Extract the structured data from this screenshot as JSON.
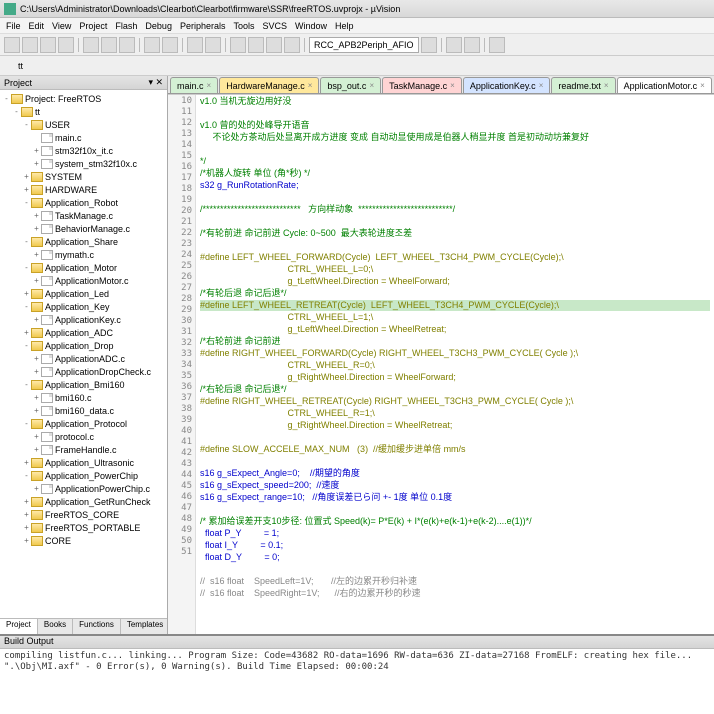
{
  "title": "C:\\Users\\Administrator\\Downloads\\Clearbot\\Clearbot\\firmware\\SSR\\freeRTOS.uvprojx - µVision",
  "menu": [
    "File",
    "Edit",
    "View",
    "Project",
    "Flash",
    "Debug",
    "Peripherals",
    "Tools",
    "SVCS",
    "Window",
    "Help"
  ],
  "toolbar": {
    "target": "tt",
    "device": "RCC_APB2Periph_AFIO"
  },
  "sidebar": {
    "title": "Project",
    "tabs": [
      "Project",
      "Books",
      "Functions",
      "Templates"
    ],
    "root": "Project: FreeRTOS",
    "nodes": [
      {
        "l": "tt",
        "t": "folder",
        "d": 1,
        "e": "-"
      },
      {
        "l": "USER",
        "t": "folder",
        "d": 2,
        "e": "-"
      },
      {
        "l": "main.c",
        "t": "file",
        "d": 3,
        "e": ""
      },
      {
        "l": "stm32f10x_it.c",
        "t": "file",
        "d": 3,
        "e": "+"
      },
      {
        "l": "system_stm32f10x.c",
        "t": "file",
        "d": 3,
        "e": "+"
      },
      {
        "l": "SYSTEM",
        "t": "folder",
        "d": 2,
        "e": "+"
      },
      {
        "l": "HARDWARE",
        "t": "folder",
        "d": 2,
        "e": "+"
      },
      {
        "l": "Application_Robot",
        "t": "folder",
        "d": 2,
        "e": "-"
      },
      {
        "l": "TaskManage.c",
        "t": "file",
        "d": 3,
        "e": "+"
      },
      {
        "l": "BehaviorManage.c",
        "t": "file",
        "d": 3,
        "e": "+"
      },
      {
        "l": "Application_Share",
        "t": "folder",
        "d": 2,
        "e": "-"
      },
      {
        "l": "mymath.c",
        "t": "file",
        "d": 3,
        "e": "+"
      },
      {
        "l": "Application_Motor",
        "t": "folder",
        "d": 2,
        "e": "-"
      },
      {
        "l": "ApplicationMotor.c",
        "t": "file",
        "d": 3,
        "e": "+"
      },
      {
        "l": "Application_Led",
        "t": "folder",
        "d": 2,
        "e": "+"
      },
      {
        "l": "Application_Key",
        "t": "folder",
        "d": 2,
        "e": "-"
      },
      {
        "l": "ApplicationKey.c",
        "t": "file",
        "d": 3,
        "e": "+"
      },
      {
        "l": "Application_ADC",
        "t": "folder",
        "d": 2,
        "e": "+"
      },
      {
        "l": "Application_Drop",
        "t": "folder",
        "d": 2,
        "e": "-"
      },
      {
        "l": "ApplicationADC.c",
        "t": "file",
        "d": 3,
        "e": "+"
      },
      {
        "l": "ApplicationDropCheck.c",
        "t": "file",
        "d": 3,
        "e": "+"
      },
      {
        "l": "Application_Bmi160",
        "t": "folder",
        "d": 2,
        "e": "-"
      },
      {
        "l": "bmi160.c",
        "t": "file",
        "d": 3,
        "e": "+"
      },
      {
        "l": "bmi160_data.c",
        "t": "file",
        "d": 3,
        "e": "+"
      },
      {
        "l": "Application_Protocol",
        "t": "folder",
        "d": 2,
        "e": "-"
      },
      {
        "l": "protocol.c",
        "t": "file",
        "d": 3,
        "e": "+"
      },
      {
        "l": "FrameHandle.c",
        "t": "file",
        "d": 3,
        "e": "+"
      },
      {
        "l": "Application_Ultrasonic",
        "t": "folder",
        "d": 2,
        "e": "+"
      },
      {
        "l": "Application_PowerChip",
        "t": "folder",
        "d": 2,
        "e": "-"
      },
      {
        "l": "ApplicationPowerChip.c",
        "t": "file",
        "d": 3,
        "e": "+"
      },
      {
        "l": "Application_GetRunCheck",
        "t": "folder",
        "d": 2,
        "e": "+"
      },
      {
        "l": "FreeRTOS_CORE",
        "t": "folder",
        "d": 2,
        "e": "+"
      },
      {
        "l": "FreeRTOS_PORTABLE",
        "t": "folder",
        "d": 2,
        "e": "+"
      },
      {
        "l": "CORE",
        "t": "folder",
        "d": 2,
        "e": "+"
      }
    ]
  },
  "editor": {
    "tabs": [
      "main.c",
      "HardwareManage.c",
      "bsp_out.c",
      "TaskManage.c",
      "ApplicationKey.c",
      "readme.txt",
      "ApplicationMotor.c"
    ],
    "active": 6,
    "startLine": 10,
    "lines": [
      {
        "c": "comment",
        "t": "v1.0 当机无旋边用好没"
      },
      {
        "c": "",
        "t": ""
      },
      {
        "c": "comment",
        "t": "v1.0 曾的处的处峰导开语音"
      },
      {
        "c": "comment",
        "t": "     不论处方茶动后处显离开成方进度 变成 自动动显使用成是伯器人稍显并度 首是初动动坊兼复好"
      },
      {
        "c": "",
        "t": ""
      },
      {
        "c": "comment",
        "t": "*/"
      },
      {
        "c": "comment",
        "t": "/*机器人旋转 单位 (角*秒) */"
      },
      {
        "c": "keyword",
        "t": "s32 g_RunRotationRate;"
      },
      {
        "c": "",
        "t": ""
      },
      {
        "c": "comment",
        "t": "/****************************   方向样动象  ***************************/"
      },
      {
        "c": "",
        "t": ""
      },
      {
        "c": "comment",
        "t": "/*有轮前进 命记前进 Cycle: 0~500  最大表轮进度조差"
      },
      {
        "c": "",
        "t": ""
      },
      {
        "c": "macro",
        "t": "#define LEFT_WHEEL_FORWARD(Cycle)  LEFT_WHEEL_T3CH4_PWM_CYCLE(Cycle);\\"
      },
      {
        "c": "macro",
        "t": "                                   CTRL_WHEEL_L=0;\\"
      },
      {
        "c": "macro",
        "t": "                                   g_tLeftWheel.Direction = WheelForward;"
      },
      {
        "c": "comment",
        "t": "/*有轮后退 命记后退*/"
      },
      {
        "c": "macro",
        "t": "#define LEFT_WHEEL_RETREAT(Cycle)  LEFT_WHEEL_T3CH4_PWM_CYCLE(Cycle);\\",
        "hl": true
      },
      {
        "c": "macro",
        "t": "                                   CTRL_WHEEL_L=1;\\"
      },
      {
        "c": "macro",
        "t": "                                   g_tLeftWheel.Direction = WheelRetreat;"
      },
      {
        "c": "comment",
        "t": "/*右轮前进 命记前进"
      },
      {
        "c": "macro",
        "t": "#define RIGHT_WHEEL_FORWARD(Cycle) RIGHT_WHEEL_T3CH3_PWM_CYCLE( Cycle );\\"
      },
      {
        "c": "macro",
        "t": "                                   CTRL_WHEEL_R=0;\\"
      },
      {
        "c": "macro",
        "t": "                                   g_tRightWheel.Direction = WheelForward;"
      },
      {
        "c": "comment",
        "t": "/*右轮后退 命记后退*/"
      },
      {
        "c": "macro",
        "t": "#define RIGHT_WHEEL_RETREAT(Cycle) RIGHT_WHEEL_T3CH3_PWM_CYCLE( Cycle );\\"
      },
      {
        "c": "macro",
        "t": "                                   CTRL_WHEEL_R=1;\\"
      },
      {
        "c": "macro",
        "t": "                                   g_tRightWheel.Direction = WheelRetreat;"
      },
      {
        "c": "",
        "t": ""
      },
      {
        "c": "macro",
        "t": "#define SLOW_ACCELE_MAX_NUM   (3)  //缓加缓步进单倍 mm/s"
      },
      {
        "c": "",
        "t": ""
      },
      {
        "c": "keyword",
        "t": "s16 g_sExpect_Angle=0;    //期望的角度"
      },
      {
        "c": "keyword",
        "t": "s16 g_sExpect_speed=200;  //速度"
      },
      {
        "c": "keyword",
        "t": "s16 g_sExpect_range=10;   //角度误差已ら问 +- 1度 单位 0.1度"
      },
      {
        "c": "",
        "t": ""
      },
      {
        "c": "comment",
        "t": "/* 累加给误差开支10步径: 位置式 Speed(k)= P*E(k) + I*(e(k)+e(k-1)+e(k-2)....e(1))*/"
      },
      {
        "c": "keyword",
        "t": "  float P_Y         = 1;"
      },
      {
        "c": "keyword",
        "t": "  float I_Y         = 0.1;"
      },
      {
        "c": "keyword",
        "t": "  float D_Y         = 0;"
      },
      {
        "c": "",
        "t": ""
      },
      {
        "c": "gray",
        "t": "//  s16 float    SpeedLeft=1V;       //左的边累开秒归补速"
      },
      {
        "c": "gray",
        "t": "//  s16 float    SpeedRight=1V;      //右的边累开秒的秒速"
      }
    ]
  },
  "output": {
    "title": "Build Output",
    "lines": [
      "compiling listfun.c...",
      "linking...",
      "Program Size: Code=43682 RO-data=1696 RW-data=636 ZI-data=27168",
      "FromELF: creating hex file...",
      "\".\\Obj\\MI.axf\" - 0 Error(s), 0 Warning(s).",
      "Build Time Elapsed:  00:00:24"
    ]
  }
}
